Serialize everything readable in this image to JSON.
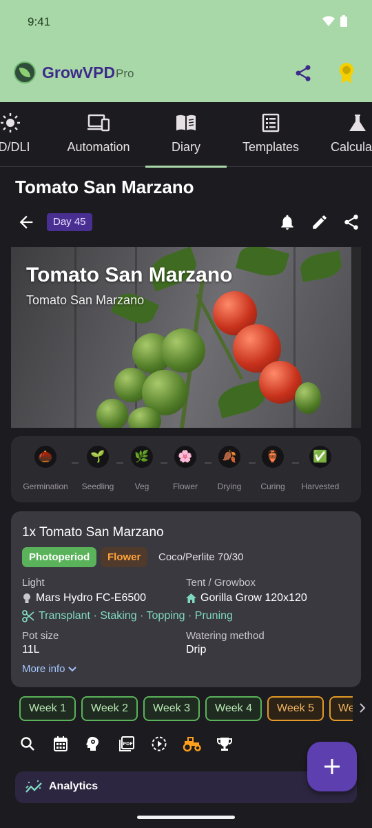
{
  "status": {
    "time": "9:41"
  },
  "app": {
    "name": "GrowVPD",
    "tier": "Pro"
  },
  "tabs": [
    {
      "label": "FD/DLI",
      "icon": "sun-icon"
    },
    {
      "label": "Automation",
      "icon": "devices-icon"
    },
    {
      "label": "Diary",
      "icon": "book-icon",
      "active": true
    },
    {
      "label": "Templates",
      "icon": "list-icon"
    },
    {
      "label": "Calcula",
      "icon": "flask-icon"
    }
  ],
  "diary": {
    "title": "Tomato San Marzano",
    "day_badge": "Day 45"
  },
  "hero": {
    "title": "Tomato San Marzano",
    "subtitle": "Tomato San Marzano"
  },
  "stages": [
    {
      "label": "Germination",
      "glyph": "🌰"
    },
    {
      "label": "Seedling",
      "glyph": "🌱"
    },
    {
      "label": "Veg",
      "glyph": "🌿"
    },
    {
      "label": "Flower",
      "glyph": "🌸"
    },
    {
      "label": "Drying",
      "glyph": "🍂"
    },
    {
      "label": "Curing",
      "glyph": "🏺"
    },
    {
      "label": "Harvested",
      "glyph": "✅"
    }
  ],
  "plant": {
    "name": "1x Tomato San Marzano",
    "chips": {
      "type": "Photoperiod",
      "stage": "Flower",
      "medium": "Coco/Perlite 70/30"
    },
    "light_label": "Light",
    "light_value": "Mars Hydro FC-E6500",
    "tent_label": "Tent / Growbox",
    "tent_value": "Gorilla Grow 120x120",
    "actions": "Transplant · Staking · Topping · Pruning",
    "pot_label": "Pot size",
    "pot_value": "11L",
    "watering_label": "Watering method",
    "watering_value": "Drip",
    "more_info": "More info"
  },
  "weeks": [
    {
      "label": "Week 1",
      "state": "green"
    },
    {
      "label": "Week 2",
      "state": "green"
    },
    {
      "label": "Week 3",
      "state": "green"
    },
    {
      "label": "Week 4",
      "state": "green"
    },
    {
      "label": "Week 5",
      "state": "orange"
    },
    {
      "label": "We",
      "state": "orange"
    }
  ],
  "toolbar": [
    "search-icon",
    "calendar-icon",
    "head-gear-icon",
    "pdf-icon",
    "timelapse-icon",
    "tractor-icon",
    "trophy-icon"
  ],
  "analytics": {
    "label": "Analytics"
  },
  "colors": {
    "appbar": "#a8d8a8",
    "accent": "#5d3fb0",
    "green": "#5ab35a",
    "orange": "#e39a27",
    "background": "#1c1b1f"
  }
}
